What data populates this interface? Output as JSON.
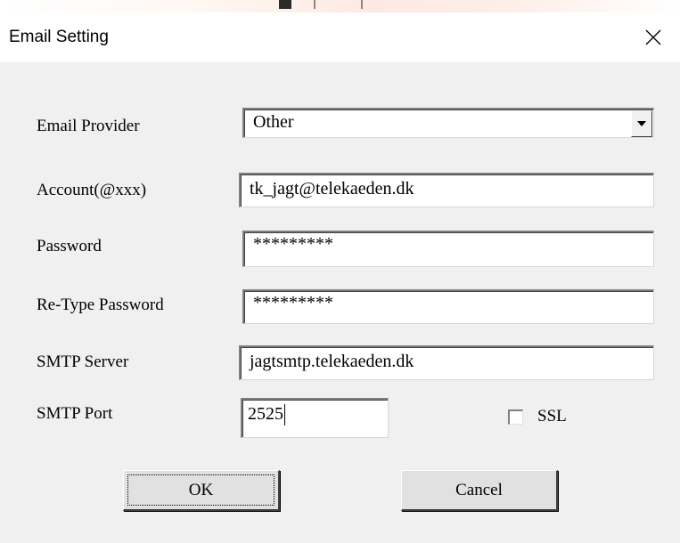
{
  "dialog": {
    "title": "Email Setting",
    "close_icon": "close-icon"
  },
  "form": {
    "provider_label": "Email Provider",
    "provider_value": "Other",
    "account_label": "Account(@xxx)",
    "account_value": "tk_jagt@telekaeden.dk",
    "password_label": "Password",
    "password_value": "*********",
    "retype_label": "Re-Type Password",
    "retype_value": "*********",
    "smtp_server_label": "SMTP Server",
    "smtp_server_value": "jagtsmtp.telekaeden.dk",
    "smtp_port_label": "SMTP Port",
    "smtp_port_value": "2525",
    "ssl_label": "SSL",
    "ssl_checked": false
  },
  "buttons": {
    "ok": "OK",
    "cancel": "Cancel"
  }
}
